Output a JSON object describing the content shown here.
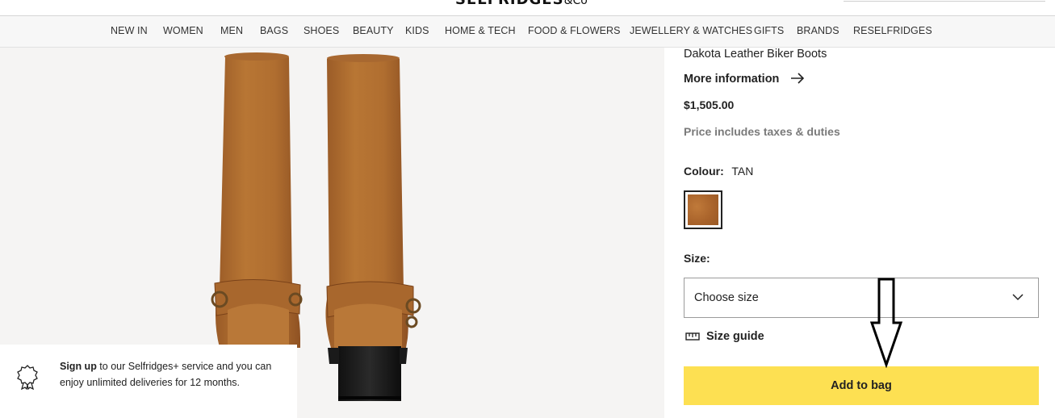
{
  "header": {
    "logo_text": "SELFRIDGES",
    "logo_suffix": "&Co"
  },
  "nav": {
    "items": [
      "NEW IN",
      "WOMEN",
      "MEN",
      "BAGS",
      "SHOES",
      "BEAUTY",
      "KIDS",
      "HOME & TECH",
      "FOOD & FLOWERS",
      "JEWELLERY & WATCHES",
      "GIFTS",
      "BRANDS",
      "RESELFRIDGES"
    ]
  },
  "product": {
    "title": "Dakota Leather Biker Boots",
    "more_info_label": "More information",
    "price": "$1,505.00",
    "tax_note": "Price includes taxes & duties",
    "colour_label": "Colour:",
    "colour_value": "TAN",
    "swatch_color": "#b06b2c",
    "size_label": "Size:",
    "size_placeholder": "Choose size",
    "size_guide_label": "Size guide",
    "add_to_bag_label": "Add to bag",
    "add_to_bag_color": "#fde052"
  },
  "signup": {
    "bold_text": "Sign up",
    "text": " to our Selfridges+ service and you can enjoy unlimited deliveries for 12 months."
  }
}
